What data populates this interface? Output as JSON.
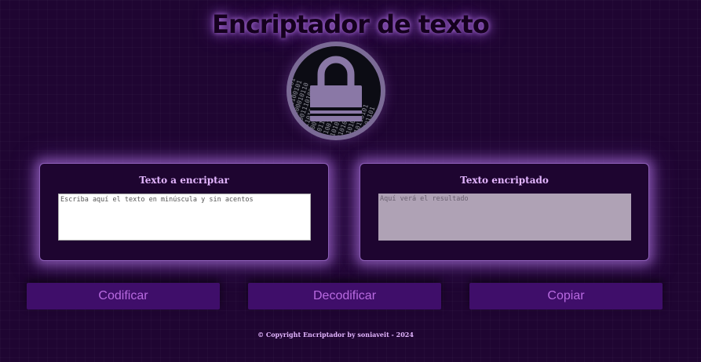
{
  "header": {
    "title": "Encriptador de texto"
  },
  "lock": {
    "icon": "lock-icon",
    "binary_text": "0100110101001\n1001011100101\n0110100010110\n1010011101001\n0011010010110\n1100101101001\n0101100110101\n1010011010010\n0110101001101\n1001010110100\n0101101001011\n1010010110101\n0110100101101\n1001011010010"
  },
  "input_card": {
    "label": "Texto a encriptar",
    "placeholder": "Escriba aquí el texto en minúscula y sin acentos",
    "value": ""
  },
  "output_card": {
    "label": "Texto encriptado",
    "placeholder": "Aquí verá el resultado",
    "value": ""
  },
  "actions": {
    "encode_label": "Codificar",
    "decode_label": "Decodificar",
    "copy_label": "Copiar"
  },
  "footer": {
    "text": "© Copyright Encriptador by soniaveit - 2024"
  },
  "colors": {
    "background": "#1f0532",
    "accent": "#e3b5ff",
    "button_bg": "#3f0e6a",
    "button_text": "#b86ae0",
    "glow": "#b478e6"
  }
}
